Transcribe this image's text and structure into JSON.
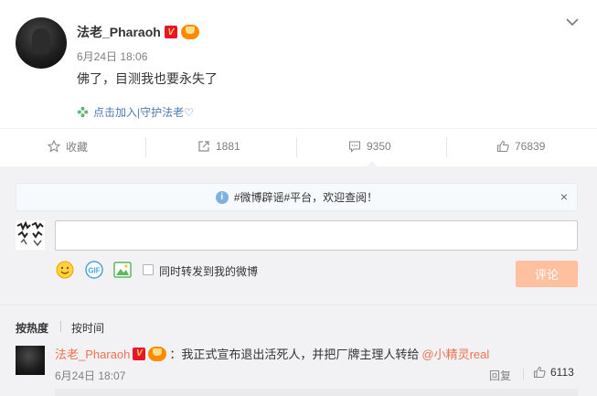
{
  "post": {
    "username": "法老_Pharaoh",
    "verified_badge": "V",
    "time": "6月24日 18:06",
    "text": "佛了，目测我也要永失了",
    "join_link": "点击加入|守护法老♡"
  },
  "actions": {
    "favorite_label": "收藏",
    "repost_count": "1881",
    "comment_count": "9350",
    "like_count": "76839"
  },
  "comment_box": {
    "notice": "#微博辟谣#平台，欢迎查阅！",
    "notice_close": "×",
    "input_value": "",
    "repost_option": "同时转发到我的微博",
    "submit_label": "评论"
  },
  "sort": {
    "hot": "按热度",
    "time": "按时间"
  },
  "comments": [
    {
      "username": "法老_Pharaoh",
      "text_before": "：我正式宣布退出活死人，并把厂牌主理人转给",
      "mention": "@小精灵real",
      "time": "6月24日 18:07",
      "reply_label": "回复",
      "likes": "6113"
    }
  ],
  "colors": {
    "link": "#507daf",
    "accent_orange": "#eb7350",
    "submit_disabled": "#ffc09f",
    "panel_bg": "#f2f2f5",
    "verified_red": "#e6162d"
  },
  "icons": {
    "more": "chevron-down-icon",
    "favorite": "star-icon",
    "repost": "share-icon",
    "comment": "comment-icon",
    "like": "thumb-up-icon",
    "notice": "info-icon",
    "emoji": "emoji-icon",
    "gif": "gif-icon",
    "image": "image-icon"
  }
}
